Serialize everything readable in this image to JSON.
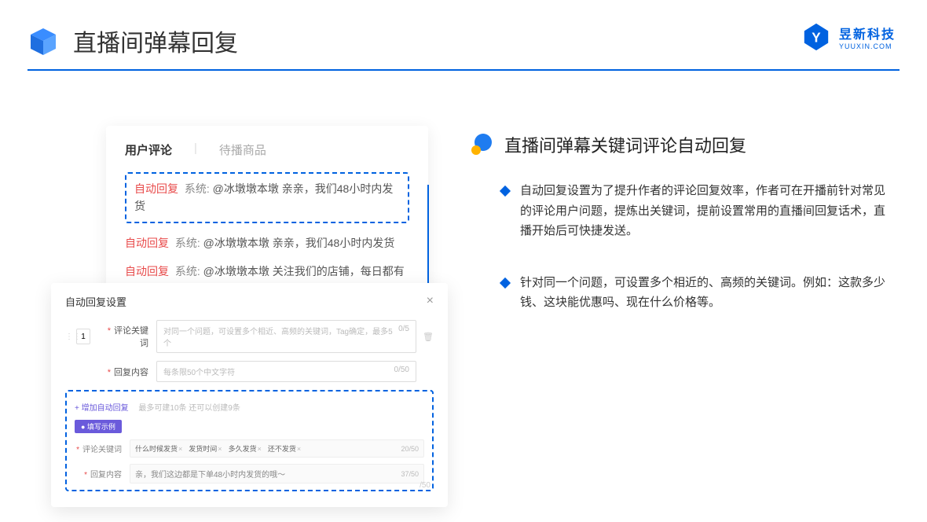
{
  "header": {
    "title": "直播间弹幕回复",
    "logo_zh": "昱新科技",
    "logo_en": "YUUXIN.COM"
  },
  "comments_card": {
    "tab_active": "用户评论",
    "tab_inactive": "待播商品",
    "highlight": {
      "tag": "自动回复",
      "sys": "系统:",
      "text": "@冰墩墩本墩 亲亲，我们48小时内发货"
    },
    "line2": {
      "tag": "自动回复",
      "sys": "系统:",
      "text": "@冰墩墩本墩 亲亲，我们48小时内发货"
    },
    "line3": {
      "tag": "自动回复",
      "sys": "系统:",
      "text": "@冰墩墩本墩 关注我们的店铺，每日都有热门推荐呦～"
    }
  },
  "settings_card": {
    "title": "自动回复设置",
    "num": "1",
    "kw_label": "评论关键词",
    "kw_placeholder": "对同一个问题，可设置多个相近、高频的关键词，Tag确定，最多5个",
    "kw_count": "0/5",
    "reply_label": "回复内容",
    "reply_placeholder": "每条限50个中文字符",
    "reply_count": "0/50",
    "add_text": "+ 增加自动回复",
    "add_hint": "最多可建10条 还可以创建9条",
    "example_badge": "● 填写示例",
    "ex_kw_label": "评论关键词",
    "ex_tags": [
      "什么时候发货",
      "发货时间",
      "多久发货",
      "还不发货"
    ],
    "ex_kw_count": "20/50",
    "ex_reply_label": "回复内容",
    "ex_reply_text": "亲，我们这边都是下单48小时内发货的哦～",
    "ex_reply_count": "37/50",
    "stray_count": "/50"
  },
  "right": {
    "title": "直播间弹幕关键词评论自动回复",
    "bullet1": "自动回复设置为了提升作者的评论回复效率，作者可在开播前针对常见的评论用户问题，提炼出关键词，提前设置常用的直播间回复话术，直播开始后可快捷发送。",
    "bullet2": "针对同一个问题，可设置多个相近的、高频的关键词。例如：这款多少钱、这块能优惠吗、现在什么价格等。"
  }
}
